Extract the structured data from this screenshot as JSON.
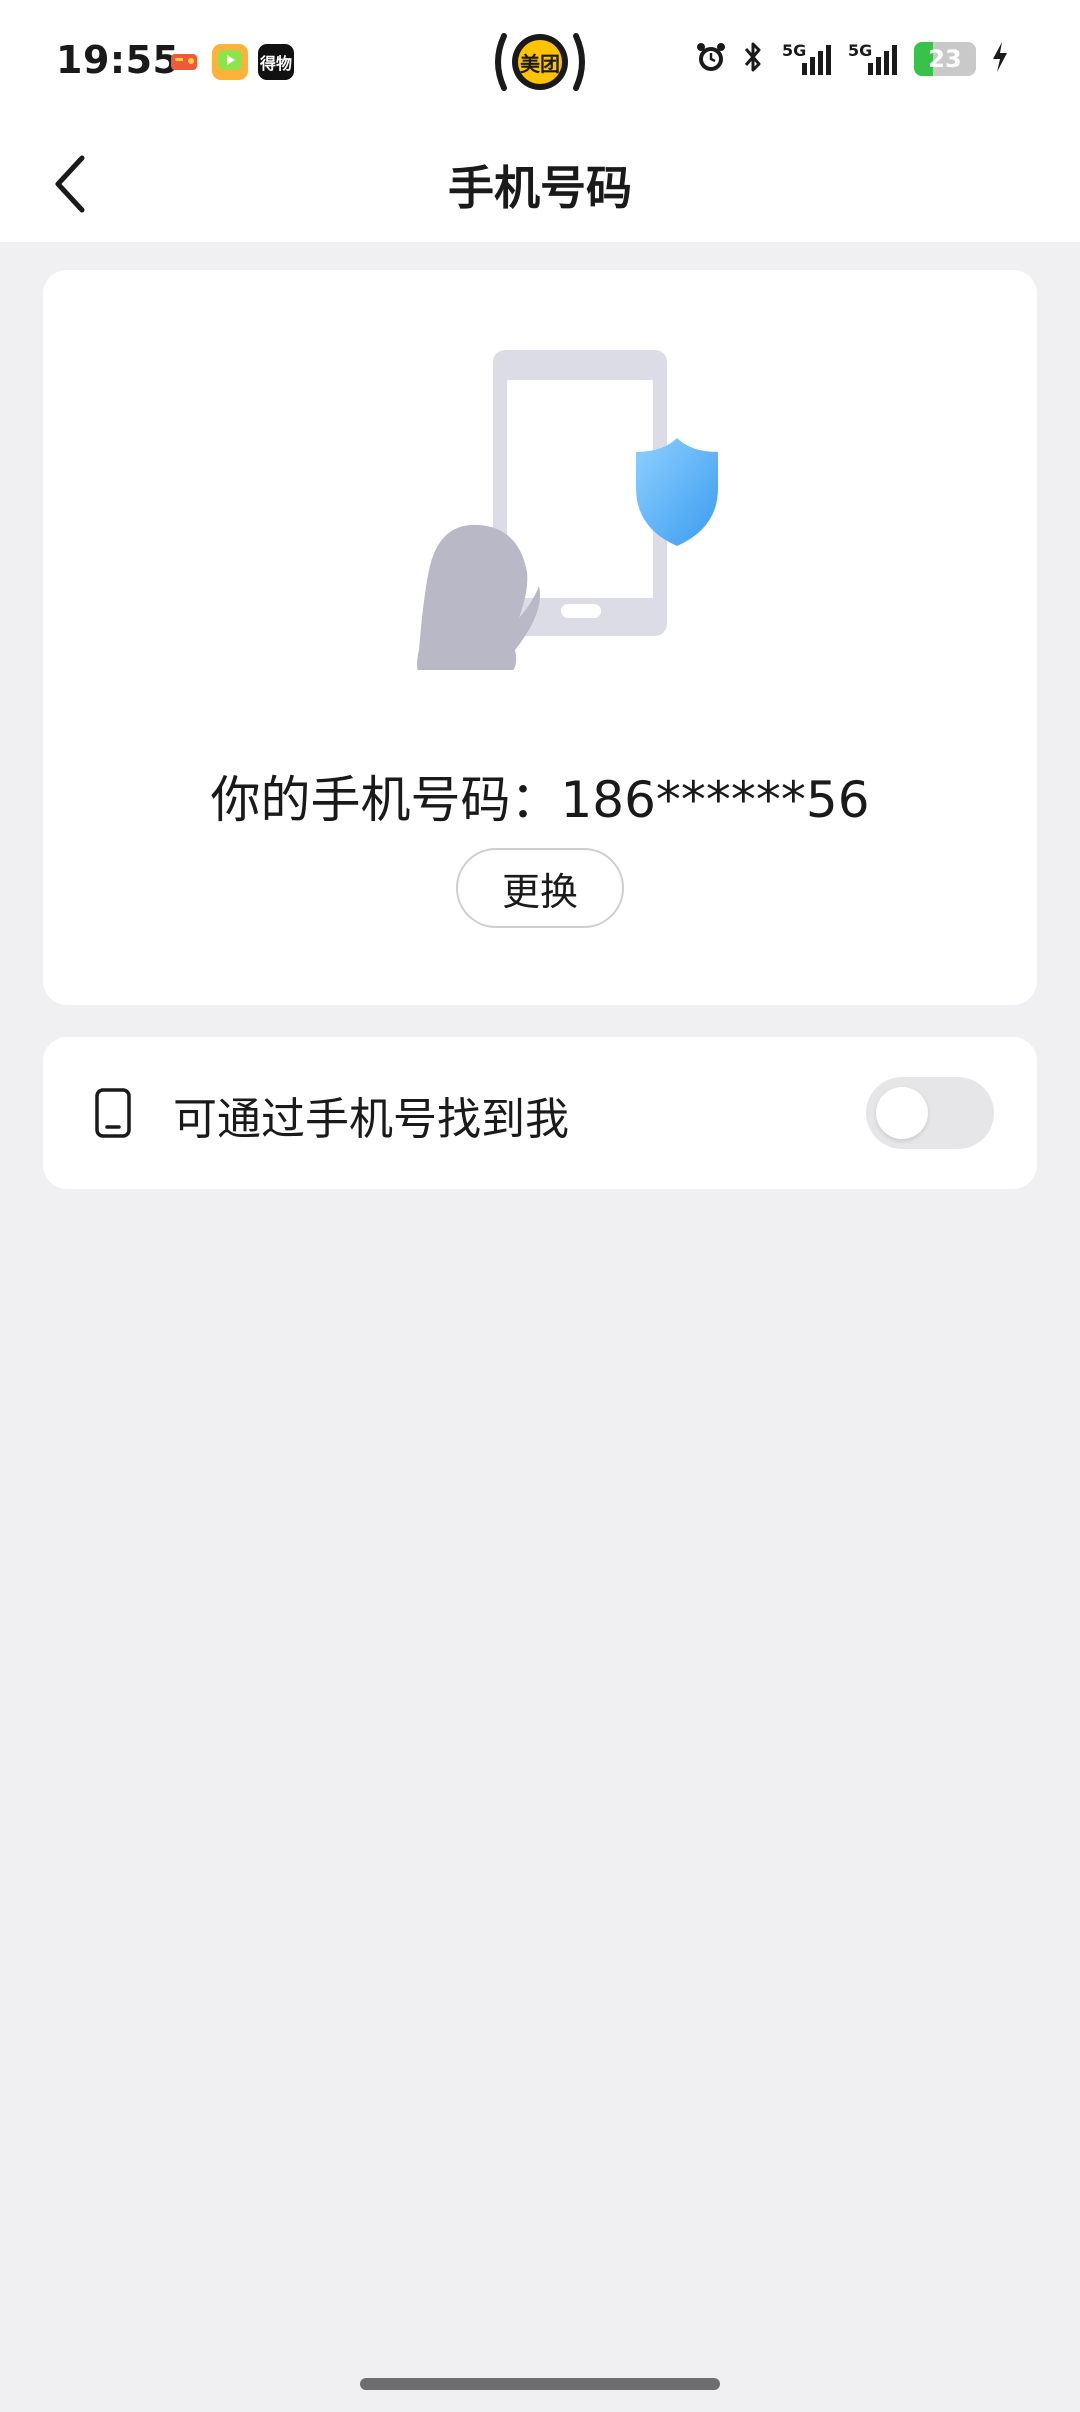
{
  "status_bar": {
    "time": "19:55",
    "battery": "23",
    "center_app_label": "美团",
    "app_icon_label": "得物",
    "signal1": "5G",
    "signal2": "5G",
    "icons": [
      "game-icon",
      "video-app-icon",
      "dewu-app-icon",
      "meituan-icon",
      "alarm-icon",
      "bluetooth-icon",
      "signal-icon",
      "signal-icon",
      "battery-icon",
      "charging-icon"
    ]
  },
  "nav": {
    "back_icon": "chevron-left-icon",
    "title": "手机号码"
  },
  "phone_card": {
    "illustration": "phone-shield-penguin",
    "phone_text": "你的手机号码：186******56",
    "change_label": "更换"
  },
  "find_me": {
    "icon": "mobile-phone-icon",
    "label": "可通过手机号找到我",
    "enabled": false
  },
  "colors": {
    "background": "#f0f0f2",
    "card": "#ffffff",
    "shield": "#4aa8f0",
    "toggle_off": "#e6e6e8"
  }
}
